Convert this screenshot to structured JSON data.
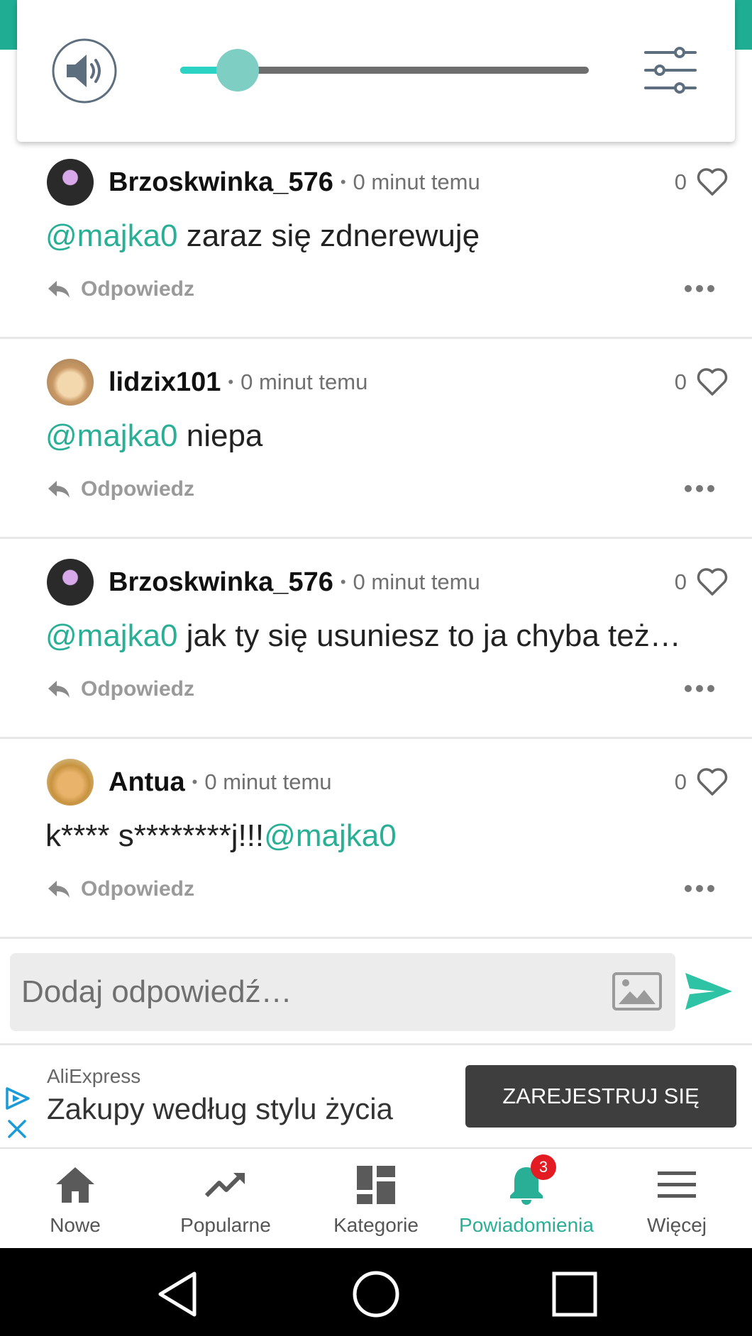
{
  "volume": {
    "level_percent": 14
  },
  "comments": [
    {
      "username": "Brzoskwinka_576",
      "time": "0 minut temu",
      "likes": "0",
      "mention": "@majka0",
      "text": " zaraz się zdnerewuję",
      "reply_label": "Odpowiedz"
    },
    {
      "username": "lidzix101",
      "time": "0 minut temu",
      "likes": "0",
      "mention": "@majka0",
      "text": " niepa",
      "reply_label": "Odpowiedz"
    },
    {
      "username": "Brzoskwinka_576",
      "time": "0 minut temu",
      "likes": "0",
      "mention": "@majka0",
      "text": " jak ty się usuniesz to ja chyba też…",
      "reply_label": "Odpowiedz"
    },
    {
      "username": "Antua",
      "time": "0 minut temu",
      "likes": "0",
      "text_before": "k**** s********j!!!",
      "mention": "@majka0",
      "reply_label": "Odpowiedz"
    }
  ],
  "reply_input": {
    "placeholder": "Dodaj odpowiedź…"
  },
  "ad": {
    "brand": "AliExpress",
    "title": "Zakupy według stylu życia",
    "cta": "ZAREJESTRUJ SIĘ"
  },
  "nav": {
    "items": [
      {
        "label": "Nowe",
        "icon": "home-icon"
      },
      {
        "label": "Popularne",
        "icon": "trending-icon"
      },
      {
        "label": "Kategorie",
        "icon": "grid-icon"
      },
      {
        "label": "Powiadomienia",
        "icon": "bell-icon",
        "badge": "3",
        "active": true
      },
      {
        "label": "Więcej",
        "icon": "menu-icon"
      }
    ]
  },
  "colors": {
    "accent": "#2aaf97",
    "badge": "#e31b23",
    "slider_fill": "#2ad3c3"
  }
}
